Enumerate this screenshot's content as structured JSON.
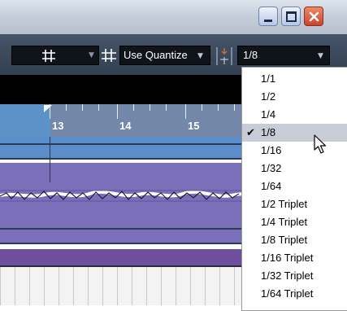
{
  "toolbar": {
    "snap_icon": "grid-icon",
    "quantize_icon": "grid-icon",
    "quantize_type": "Use Quantize",
    "length_icon": "length-quantize-icon",
    "length_value": "1/8"
  },
  "ruler": {
    "bars": [
      "13",
      "14",
      "15"
    ]
  },
  "menu": {
    "selected": "1/8",
    "items": [
      "1/1",
      "1/2",
      "1/4",
      "1/8",
      "1/16",
      "1/32",
      "1/64",
      "1/2 Triplet",
      "1/4 Triplet",
      "1/8 Triplet",
      "1/16 Triplet",
      "1/32 Triplet",
      "1/64 Triplet"
    ]
  },
  "colors": {
    "toolbar": "#3b4759",
    "ruler": "#7388a8",
    "track_audio": "#7a6fb8",
    "track_blue": "#5b8ecb",
    "menu_highlight": "#c8ccd6"
  }
}
